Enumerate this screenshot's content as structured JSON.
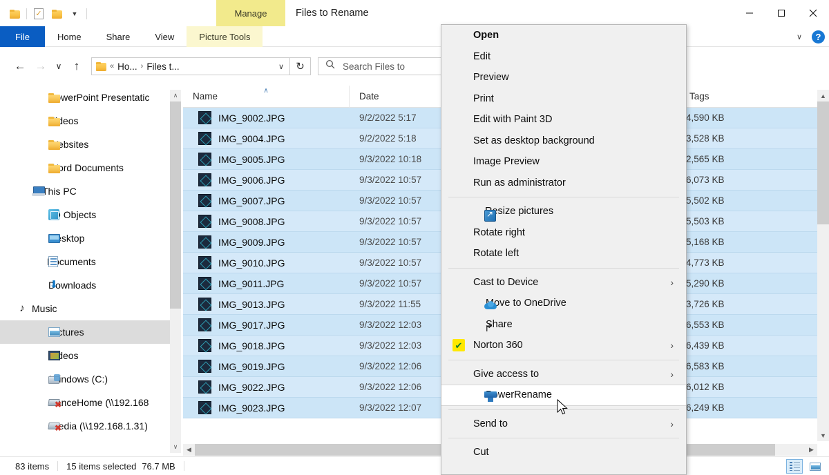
{
  "window": {
    "title": "Files to Rename",
    "context_tab_group": "Manage",
    "minimize_label": "Minimize",
    "maximize_label": "Maximize",
    "close_label": "Close"
  },
  "quick_access": {
    "items": [
      {
        "name": "folder-icon",
        "label": "Explorer"
      },
      {
        "name": "properties-icon",
        "label": "Properties"
      },
      {
        "name": "new-folder-icon",
        "label": "New folder"
      },
      {
        "name": "customize-dropdown",
        "label": "Customize Quick Access Toolbar"
      }
    ]
  },
  "ribbon": {
    "tabs": [
      {
        "id": "file",
        "label": "File"
      },
      {
        "id": "home",
        "label": "Home"
      },
      {
        "id": "share",
        "label": "Share"
      },
      {
        "id": "view",
        "label": "View"
      },
      {
        "id": "picture-tools",
        "label": "Picture Tools"
      }
    ],
    "collapse_label": "∨",
    "help_label": "?"
  },
  "address": {
    "back_label": "←",
    "forward_label": "→",
    "recent_label": "∨",
    "up_label": "↑",
    "overflow": "«",
    "crumbs": [
      "Ho...",
      "Files t..."
    ],
    "separator": "›",
    "dropdown": "∨",
    "refresh_label": "↻"
  },
  "search": {
    "icon": "search-icon",
    "placeholder": "Search Files to"
  },
  "nav_pane": {
    "items": [
      {
        "label": "PowerPoint Presentatic",
        "icon": "folder-icon",
        "level": 2,
        "selected": false
      },
      {
        "label": "Videos",
        "icon": "folder-icon",
        "level": 2,
        "selected": false
      },
      {
        "label": "Websites",
        "icon": "folder-icon",
        "level": 2,
        "selected": false
      },
      {
        "label": "Word Documents",
        "icon": "folder-icon",
        "level": 2,
        "selected": false
      },
      {
        "label": "This PC",
        "icon": "pc-icon",
        "level": 1,
        "selected": false
      },
      {
        "label": "3D Objects",
        "icon": "3d-objects-icon",
        "level": 2,
        "selected": false
      },
      {
        "label": "Desktop",
        "icon": "desktop-icon",
        "level": 2,
        "selected": false
      },
      {
        "label": "Documents",
        "icon": "documents-icon",
        "level": 2,
        "selected": false
      },
      {
        "label": "Downloads",
        "icon": "downloads-icon",
        "level": 2,
        "selected": false
      },
      {
        "label": "Music",
        "icon": "music-icon",
        "level": 2,
        "selected": false
      },
      {
        "label": "Pictures",
        "icon": "pictures-icon",
        "level": 2,
        "selected": true
      },
      {
        "label": "Videos",
        "icon": "videos-icon",
        "level": 2,
        "selected": false
      },
      {
        "label": "Windows (C:)",
        "icon": "drive-icon",
        "level": 2,
        "selected": false
      },
      {
        "label": "LanceHome (\\\\192.168",
        "icon": "network-drive-icon",
        "level": 2,
        "selected": false
      },
      {
        "label": "Media (\\\\192.168.1.31)",
        "icon": "network-drive-icon",
        "level": 2,
        "selected": false
      }
    ],
    "scroll_up": "∧",
    "scroll_down": "∨"
  },
  "file_list": {
    "columns": [
      {
        "id": "name",
        "label": "Name",
        "sorted": true,
        "sort_glyph": "∧"
      },
      {
        "id": "date",
        "label": "Date",
        "sorted": false
      },
      {
        "id": "tags",
        "label": "Tags",
        "sorted": false
      }
    ],
    "rows": [
      {
        "name": "IMG_9002.JPG",
        "date": "9/2/2022 5:17",
        "size": "4,590 KB",
        "selected": true
      },
      {
        "name": "IMG_9004.JPG",
        "date": "9/2/2022 5:18",
        "size": "3,528 KB",
        "selected": true
      },
      {
        "name": "IMG_9005.JPG",
        "date": "9/3/2022 10:18",
        "size": "2,565 KB",
        "selected": true
      },
      {
        "name": "IMG_9006.JPG",
        "date": "9/3/2022 10:57",
        "size": "6,073 KB",
        "selected": true
      },
      {
        "name": "IMG_9007.JPG",
        "date": "9/3/2022 10:57",
        "size": "5,502 KB",
        "selected": true
      },
      {
        "name": "IMG_9008.JPG",
        "date": "9/3/2022 10:57",
        "size": "5,503 KB",
        "selected": true
      },
      {
        "name": "IMG_9009.JPG",
        "date": "9/3/2022 10:57",
        "size": "5,168 KB",
        "selected": true
      },
      {
        "name": "IMG_9010.JPG",
        "date": "9/3/2022 10:57",
        "size": "4,773 KB",
        "selected": true
      },
      {
        "name": "IMG_9011.JPG",
        "date": "9/3/2022 10:57",
        "size": "5,290 KB",
        "selected": true
      },
      {
        "name": "IMG_9013.JPG",
        "date": "9/3/2022 11:55",
        "size": "3,726 KB",
        "selected": true
      },
      {
        "name": "IMG_9017.JPG",
        "date": "9/3/2022 12:03",
        "size": "6,553 KB",
        "selected": true
      },
      {
        "name": "IMG_9018.JPG",
        "date": "9/3/2022 12:03",
        "size": "6,439 KB",
        "selected": true
      },
      {
        "name": "IMG_9019.JPG",
        "date": "9/3/2022 12:06",
        "size": "6,583 KB",
        "selected": true
      },
      {
        "name": "IMG_9022.JPG",
        "date": "9/3/2022 12:06",
        "size": "6,012 KB",
        "selected": true
      },
      {
        "name": "IMG_9023.JPG",
        "date": "9/3/2022 12:07",
        "size": "6,249 KB",
        "selected": true
      }
    ]
  },
  "context_menu": {
    "items": [
      {
        "label": "Open",
        "bold": true,
        "icon": null,
        "submenu": false
      },
      {
        "label": "Edit",
        "bold": false,
        "icon": null,
        "submenu": false
      },
      {
        "label": "Preview",
        "bold": false,
        "icon": null,
        "submenu": false
      },
      {
        "label": "Print",
        "bold": false,
        "icon": null,
        "submenu": false
      },
      {
        "label": "Edit with Paint 3D",
        "bold": false,
        "icon": null,
        "submenu": false
      },
      {
        "label": "Set as desktop background",
        "bold": false,
        "icon": null,
        "submenu": false
      },
      {
        "label": "Image Preview",
        "bold": false,
        "icon": null,
        "submenu": false
      },
      {
        "label": "Run as administrator",
        "bold": false,
        "icon": null,
        "submenu": false
      },
      {
        "separator": true
      },
      {
        "label": "Resize pictures",
        "bold": false,
        "icon": "resize-pictures-icon",
        "submenu": false
      },
      {
        "label": "Rotate right",
        "bold": false,
        "icon": null,
        "submenu": false
      },
      {
        "label": "Rotate left",
        "bold": false,
        "icon": null,
        "submenu": false
      },
      {
        "separator": true
      },
      {
        "label": "Cast to Device",
        "bold": false,
        "icon": null,
        "submenu": true
      },
      {
        "label": "Move to OneDrive",
        "bold": false,
        "icon": "onedrive-icon",
        "submenu": false
      },
      {
        "label": "Share",
        "bold": false,
        "icon": "share-icon",
        "submenu": false
      },
      {
        "label": "Norton 360",
        "bold": false,
        "icon": "norton-icon",
        "submenu": true
      },
      {
        "separator": true
      },
      {
        "label": "Give access to",
        "bold": false,
        "icon": null,
        "submenu": true
      },
      {
        "label": "PowerRename",
        "bold": false,
        "icon": "powerrename-icon",
        "submenu": false,
        "hover": true
      },
      {
        "separator": true
      },
      {
        "label": "Send to",
        "bold": false,
        "icon": null,
        "submenu": true
      },
      {
        "separator": true
      },
      {
        "label": "Cut",
        "bold": false,
        "icon": null,
        "submenu": false
      }
    ],
    "submenu_glyph": "›"
  },
  "status_bar": {
    "item_count": "83 items",
    "selection": "15 items selected",
    "selection_size": "76.7 MB",
    "view_buttons": [
      {
        "name": "details-view-button",
        "label": "Details view",
        "active": true
      },
      {
        "name": "large-icons-view-button",
        "label": "Large icons view",
        "active": false
      }
    ]
  },
  "colors": {
    "accent": "#0a5dc2",
    "selection": "#cce5f7",
    "context_tab": "#f2ea8c",
    "menu_bg": "#f0f0f0"
  }
}
